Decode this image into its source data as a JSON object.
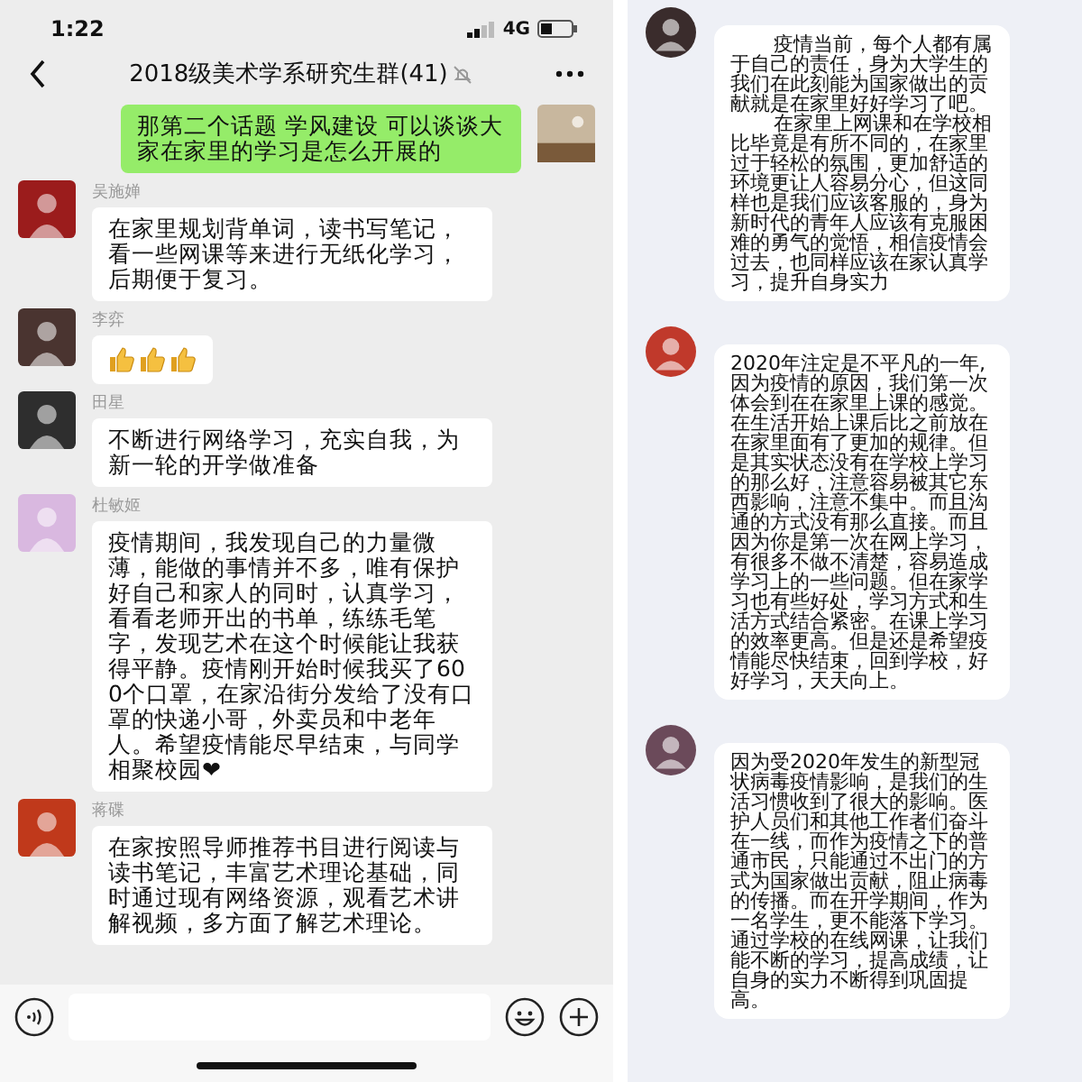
{
  "left_phone": {
    "status_bar": {
      "time": "1:22",
      "network": "4G"
    },
    "header": {
      "title": "2018级美术学系研究生群(41)",
      "muted": true
    },
    "messages": [
      {
        "kind": "own",
        "text": "那第二个话题 学风建设 可以谈谈大家在家里的学习是怎么开展的",
        "color": "#c8b79e"
      },
      {
        "kind": "text",
        "sender": "吴施婵",
        "text": "在家里规划背单词，读书写笔记，看一些网课等来进行无纸化学习，后期便于复习。",
        "color": "#9b1c1c"
      },
      {
        "kind": "reactions",
        "sender": "李弈",
        "reactions": [
          {
            "kind": "thumbs_up"
          },
          {
            "kind": "thumbs_up"
          },
          {
            "kind": "thumbs_up"
          }
        ],
        "color": "#4a3430"
      },
      {
        "kind": "text",
        "sender": "田星",
        "text": "不断进行网络学习，充实自我，为新一轮的开学做准备",
        "color": "#2e2e2e"
      },
      {
        "kind": "text",
        "sender": "杜敏姬",
        "text": "疫情期间，我发现自己的力量微薄，能做的事情并不多，唯有保护好自己和家人的同时，认真学习，看看老师开出的书单，练练毛笔字，发现艺术在这个时候能让我获得平静。疫情刚开始时候我买了600个口罩，在家沿街分发给了没有口罩的快递小哥，外卖员和中老年人。希望疫情能尽早结束，与同学相聚校园❤",
        "color": "#d9b8e0"
      },
      {
        "kind": "text",
        "sender": "蒋碟",
        "text": "在家按照导师推荐书目进行阅读与读书笔记，丰富艺术理论基础，同时通过现有网络资源，观看艺术讲解视频，多方面了解艺术理论。",
        "color": "#c0391b"
      }
    ]
  },
  "right_phone": {
    "messages": [
      {
        "paragraphs": [
          "疫情当前，每个人都有属于自己的责任，身为大学生的我们在此刻能为国家做出的贡献就是在家里好好学习了吧。",
          "在家里上网课和在学校相比毕竟是有所不同的，在家里过于轻松的氛围，更加舒适的环境更让人容易分心，但这同样也是我们应该客服的，身为新时代的青年人应该有克服困难的勇气的觉悟，相信疫情会过去，也同样应该在家认真学习，提升自身实力"
        ],
        "color": "#3a2c2c"
      },
      {
        "paragraphs": [
          "2020年注定是不平凡的一年,因为疫情的原因，我们第一次体会到在在家里上课的感觉。在生活开始上课后比之前放在在家里面有了更加的规律。但是其实状态没有在学校上学习的那么好，注意容易被其它东西影响，注意不集中。而且沟通的方式没有那么直接。而且因为你是第一次在网上学习，有很多不做不清楚，容易造成学习上的一些问题。但在家学习也有些好处，学习方式和生活方式结合紧密。在课上学习的效率更高。但是还是希望疫情能尽快结束，回到学校，好好学习，天天向上。"
        ],
        "color": "#c0392b"
      },
      {
        "paragraphs": [
          "因为受2020年发生的新型冠状病毒疫情影响，是我们的生活习惯收到了很大的影响。医护人员们和其他工作者们奋斗在一线，而作为疫情之下的普通市民，只能通过不出门的方式为国家做出贡献，阻止病毒的传播。而在开学期间，作为一名学生，更不能落下学习。通过学校的在线网课，让我们能不断的学习，提高成绩，让自身的实力不断得到巩固提高。"
        ],
        "color": "#6b4a5a"
      }
    ]
  }
}
